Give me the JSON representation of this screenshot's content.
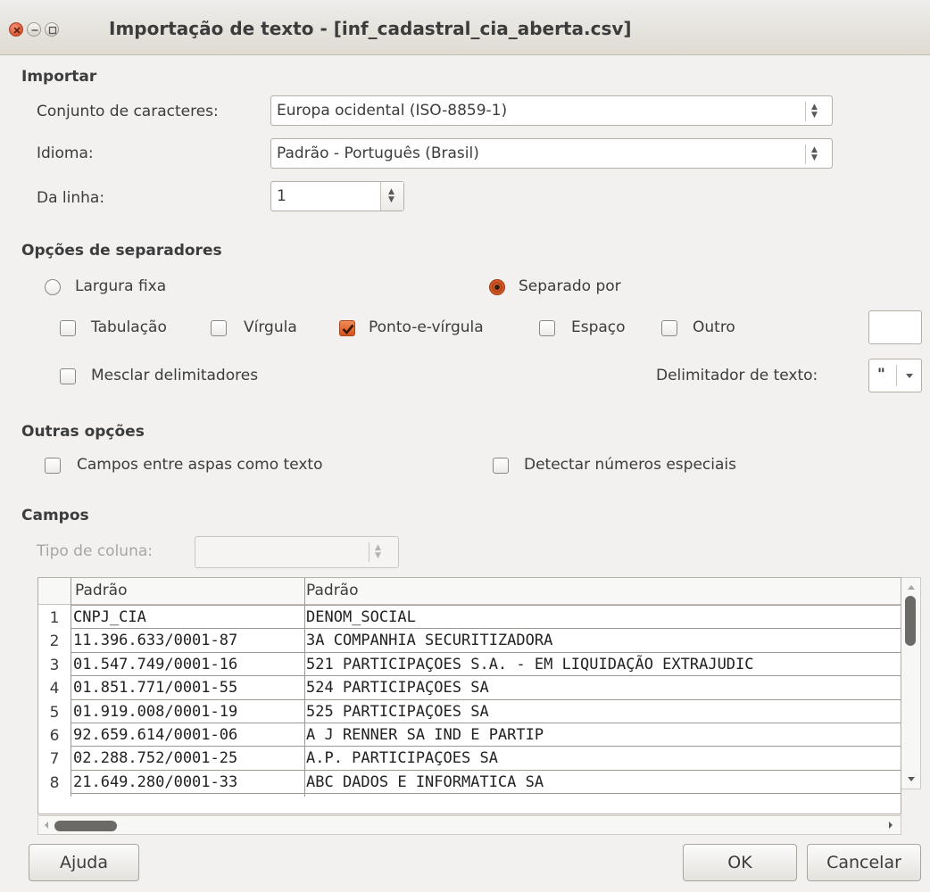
{
  "window": {
    "title": "Importação de texto - [inf_cadastral_cia_aberta.csv]"
  },
  "import": {
    "section_label": "Importar",
    "charset_label": "Conjunto de caracteres:",
    "charset_value": "Europa ocidental (ISO-8859-1)",
    "language_label": "Idioma:",
    "language_value": "Padrão - Português (Brasil)",
    "from_row_label": "Da linha:",
    "from_row_value": "1"
  },
  "separator_options": {
    "section_label": "Opções de separadores",
    "fixed_width_label": "Largura fixa",
    "fixed_width_selected": false,
    "separated_by_label": "Separado por",
    "separated_by_selected": true,
    "tab_label": "Tabulação",
    "tab_checked": false,
    "comma_label": "Vírgula",
    "comma_checked": false,
    "semicolon_label": "Ponto-e-vírgula",
    "semicolon_checked": true,
    "space_label": "Espaço",
    "space_checked": false,
    "other_label": "Outro",
    "other_checked": false,
    "other_value": "",
    "merge_label": "Mesclar delimitadores",
    "merge_checked": false,
    "text_delimiter_label": "Delimitador de texto:",
    "text_delimiter_value": "\""
  },
  "other_options": {
    "section_label": "Outras opções",
    "quoted_as_text_label": "Campos entre aspas como texto",
    "quoted_as_text_checked": false,
    "detect_special_label": "Detectar números especiais",
    "detect_special_checked": false
  },
  "fields": {
    "section_label": "Campos",
    "column_type_label": "Tipo de coluna:",
    "column_type_value": "",
    "headers": [
      "Padrão",
      "Padrão"
    ],
    "rows": [
      {
        "num": "1",
        "c1": "CNPJ_CIA",
        "c2": "DENOM_SOCIAL"
      },
      {
        "num": "2",
        "c1": "11.396.633/0001-87",
        "c2": "3A COMPANHIA SECURITIZADORA"
      },
      {
        "num": "3",
        "c1": "01.547.749/0001-16",
        "c2": "521 PARTICIPAÇOES S.A. - EM LIQUIDAÇÃO EXTRAJUDIC"
      },
      {
        "num": "4",
        "c1": "01.851.771/0001-55",
        "c2": "524 PARTICIPAÇOES SA"
      },
      {
        "num": "5",
        "c1": "01.919.008/0001-19",
        "c2": "525 PARTICIPAÇOES SA"
      },
      {
        "num": "6",
        "c1": "92.659.614/0001-06",
        "c2": "A J RENNER SA IND E PARTIP"
      },
      {
        "num": "7",
        "c1": "02.288.752/0001-25",
        "c2": "A.P. PARTICIPAÇOES SA"
      },
      {
        "num": "8",
        "c1": "21.649.280/0001-33",
        "c2": "ABC DADOS E INFORMATICA SA"
      }
    ]
  },
  "buttons": {
    "help": "Ajuda",
    "ok": "OK",
    "cancel": "Cancelar"
  },
  "colors": {
    "accent": "#d5521c",
    "background": "#f2f1f0"
  }
}
